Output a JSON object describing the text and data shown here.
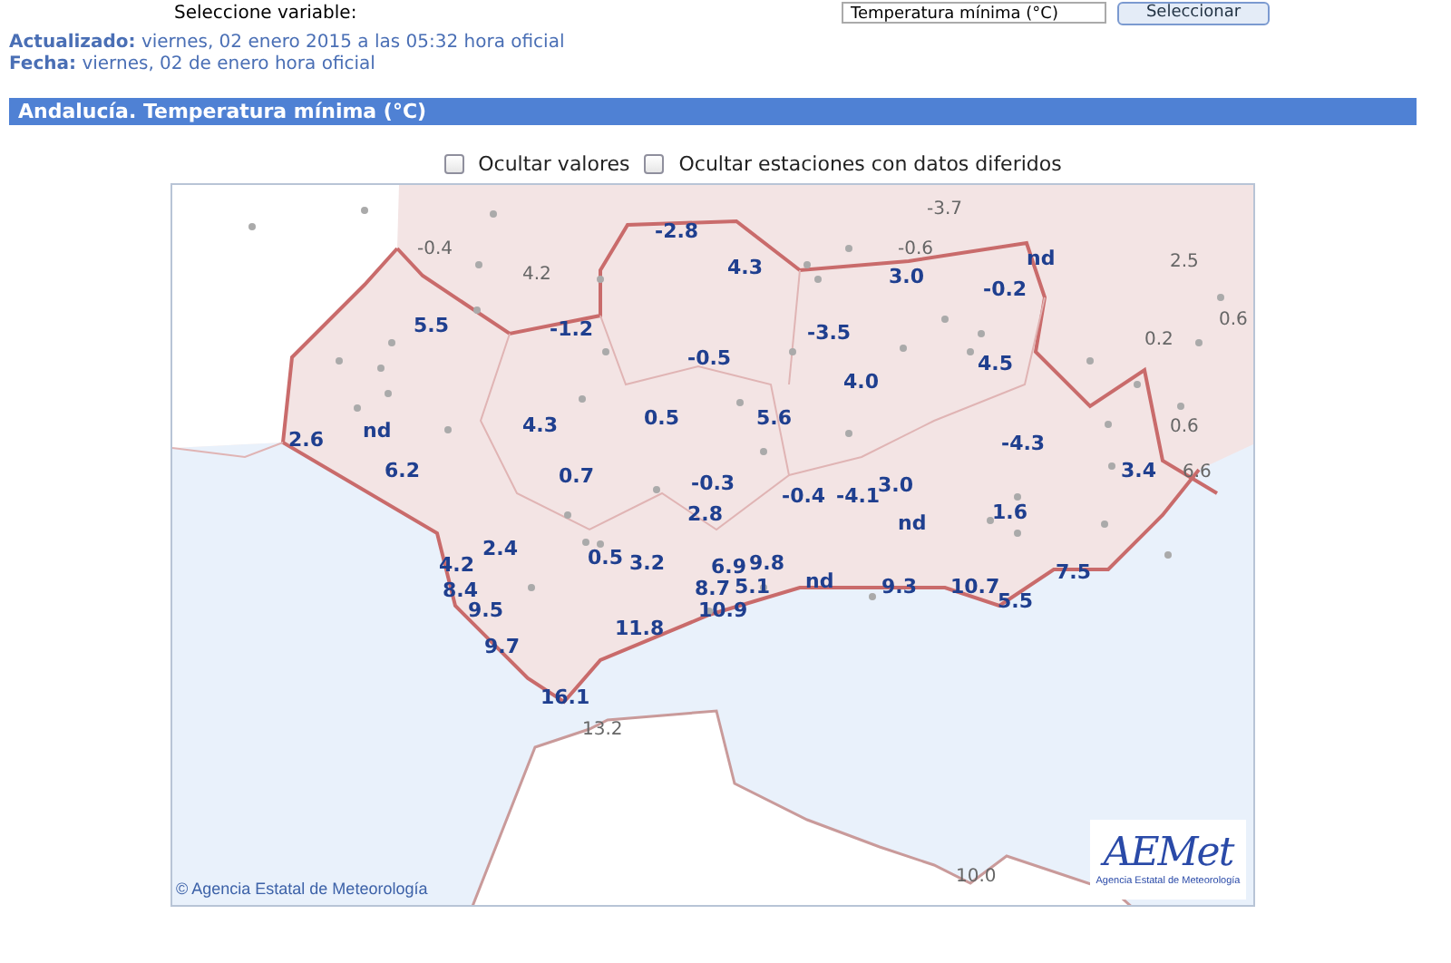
{
  "selector": {
    "label": "Seleccione variable:",
    "value": "Temperatura mínima (°C)",
    "button": "Seleccionar"
  },
  "meta": [
    {
      "label": "Actualizado:",
      "value": "viernes, 02 enero 2015 a las 05:32 hora oficial"
    },
    {
      "label": "Fecha:",
      "value": "viernes, 02 de enero hora oficial"
    }
  ],
  "title": "Andalucía. Temperatura mínima (°C)",
  "options": [
    {
      "label": "Ocultar valores",
      "checked": false
    },
    {
      "label": "Ocultar estaciones con datos diferidos",
      "checked": false
    }
  ],
  "map": {
    "copyright": "© Agencia Estatal de Meteorología",
    "logo": {
      "wordmark": "AEMet",
      "caption": "Agencia Estatal de Meteorología"
    },
    "values": [
      {
        "value": "-3.7",
        "kind": "outside"
      },
      {
        "value": "-2.8",
        "kind": "region"
      },
      {
        "value": "-0.4",
        "kind": "outside"
      },
      {
        "value": "4.2",
        "kind": "outside"
      },
      {
        "value": "4.3",
        "kind": "region"
      },
      {
        "value": "-0.6",
        "kind": "outside"
      },
      {
        "value": "3.0",
        "kind": "region"
      },
      {
        "value": "nd",
        "kind": "region"
      },
      {
        "value": "2.5",
        "kind": "outside"
      },
      {
        "value": "-0.2",
        "kind": "region"
      },
      {
        "value": "5.5",
        "kind": "region"
      },
      {
        "value": "-1.2",
        "kind": "region"
      },
      {
        "value": "-3.5",
        "kind": "region"
      },
      {
        "value": "0.2",
        "kind": "outside"
      },
      {
        "value": "0.6",
        "kind": "outside"
      },
      {
        "value": "-0.5",
        "kind": "region"
      },
      {
        "value": "4.0",
        "kind": "region"
      },
      {
        "value": "4.5",
        "kind": "region"
      },
      {
        "value": "2.6",
        "kind": "region"
      },
      {
        "value": "nd",
        "kind": "region"
      },
      {
        "value": "4.3",
        "kind": "region"
      },
      {
        "value": "0.5",
        "kind": "region"
      },
      {
        "value": "5.6",
        "kind": "region"
      },
      {
        "value": "-4.3",
        "kind": "region"
      },
      {
        "value": "0.6",
        "kind": "outside"
      },
      {
        "value": "6.2",
        "kind": "region"
      },
      {
        "value": "0.7",
        "kind": "region"
      },
      {
        "value": "-0.3",
        "kind": "region"
      },
      {
        "value": "-0.4",
        "kind": "region"
      },
      {
        "value": "-4.1",
        "kind": "region"
      },
      {
        "value": "3.0",
        "kind": "region"
      },
      {
        "value": "3.4",
        "kind": "region"
      },
      {
        "value": "6.6",
        "kind": "outside"
      },
      {
        "value": "2.8",
        "kind": "region"
      },
      {
        "value": "nd",
        "kind": "region"
      },
      {
        "value": "1.6",
        "kind": "region"
      },
      {
        "value": "4.2",
        "kind": "region"
      },
      {
        "value": "2.4",
        "kind": "region"
      },
      {
        "value": "0.5",
        "kind": "region"
      },
      {
        "value": "3.2",
        "kind": "region"
      },
      {
        "value": "6.9",
        "kind": "region"
      },
      {
        "value": "9.8",
        "kind": "region"
      },
      {
        "value": "5.1",
        "kind": "region"
      },
      {
        "value": "nd",
        "kind": "region"
      },
      {
        "value": "9.3",
        "kind": "region"
      },
      {
        "value": "10.7",
        "kind": "region"
      },
      {
        "value": "7.5",
        "kind": "region"
      },
      {
        "value": "8.4",
        "kind": "region"
      },
      {
        "value": "8.7",
        "kind": "region"
      },
      {
        "value": "9.5",
        "kind": "region"
      },
      {
        "value": "10.9",
        "kind": "region"
      },
      {
        "value": "5.5",
        "kind": "region"
      },
      {
        "value": "11.8",
        "kind": "region"
      },
      {
        "value": "9.7",
        "kind": "region"
      },
      {
        "value": "16.1",
        "kind": "region"
      },
      {
        "value": "13.2",
        "kind": "outside"
      },
      {
        "value": "10.0",
        "kind": "outside"
      }
    ]
  }
}
